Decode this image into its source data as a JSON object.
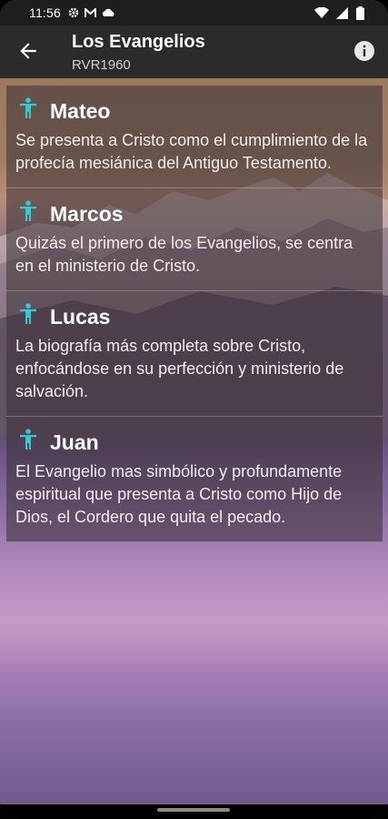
{
  "status": {
    "time": "11:56",
    "left_icons": [
      "gear-icon",
      "gmail-icon",
      "cloud-icon"
    ],
    "right_icons": [
      "wifi-icon",
      "signal-icon",
      "battery-icon"
    ]
  },
  "appbar": {
    "title": "Los Evangelios",
    "subtitle": "RVR1960"
  },
  "colors": {
    "icon_accent": "#38c8d4",
    "appbar_bg": "#2b2b2b"
  },
  "gospels": [
    {
      "name": "Mateo",
      "description": "Se presenta a Cristo como el cumplimiento de la profecía mesiánica del Antiguo Testamento."
    },
    {
      "name": "Marcos",
      "description": "Quizás el primero de los Evangelios, se centra en el ministerio de Cristo."
    },
    {
      "name": "Lucas",
      "description": "La biografía más completa sobre Cristo, enfocándose en su perfección y ministerio de salvación."
    },
    {
      "name": "Juan",
      "description": "El Evangelio mas simbólico y profundamente espiritual que presenta a Cristo como Hijo de Dios, el Cordero que quita el pecado."
    }
  ]
}
